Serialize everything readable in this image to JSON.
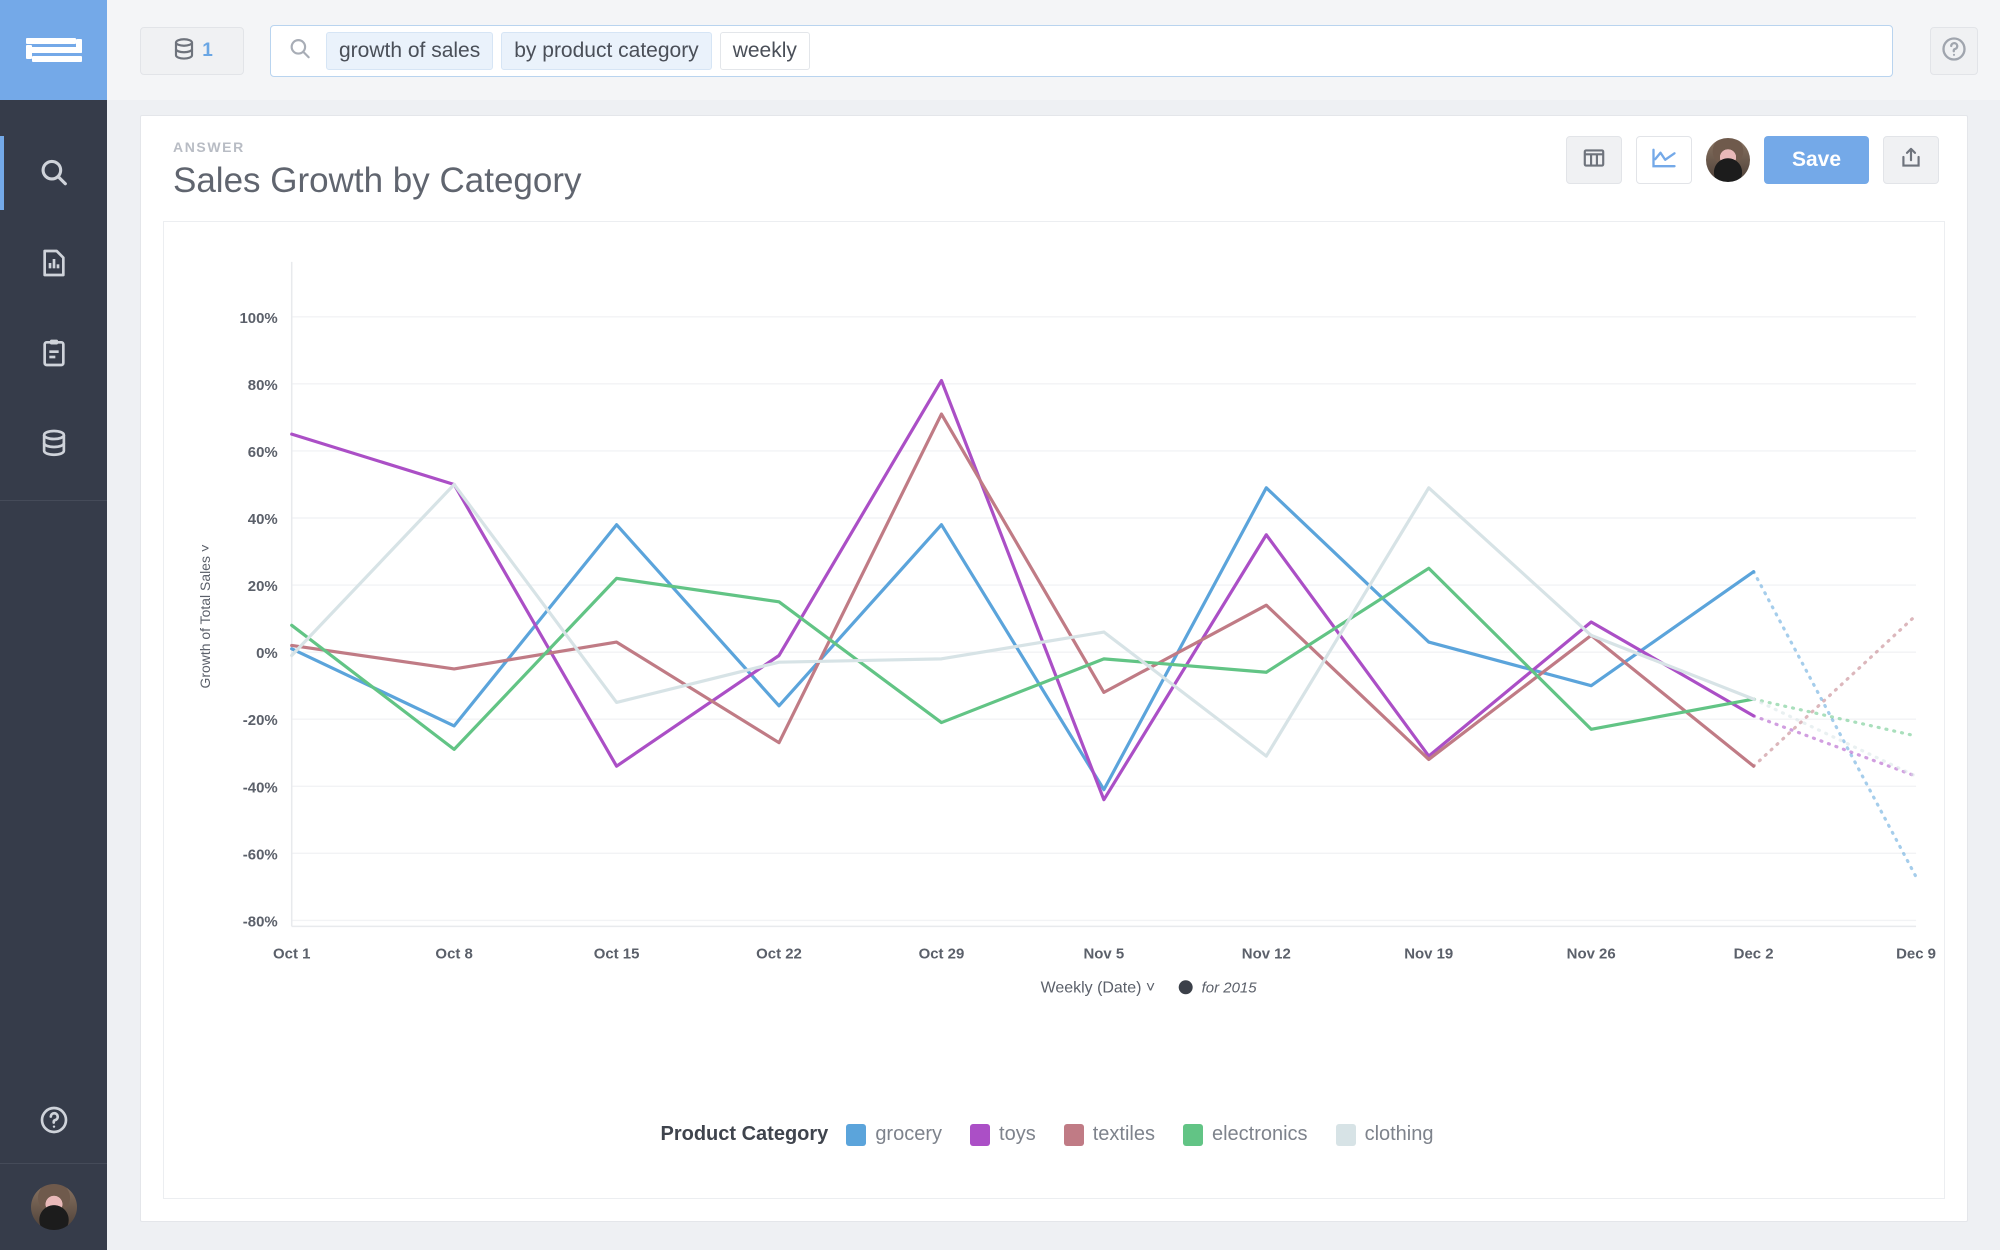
{
  "rail": {
    "logo_name": "thoughtspot-logo",
    "items": [
      {
        "name": "search",
        "icon": "search-icon",
        "active": true
      },
      {
        "name": "answers",
        "icon": "chart-document-icon",
        "active": false
      },
      {
        "name": "pinboards",
        "icon": "clipboard-icon",
        "active": false
      },
      {
        "name": "data",
        "icon": "database-icon",
        "active": false
      }
    ],
    "bottom": [
      {
        "name": "help",
        "icon": "help-circle-icon"
      },
      {
        "name": "profile",
        "icon": "avatar"
      }
    ]
  },
  "topbar": {
    "source_count": "1",
    "source_icon": "database-icon",
    "search_icon": "search-icon",
    "help_icon": "help-circle-icon",
    "tokens": [
      {
        "text": "growth of sales",
        "style": "filled"
      },
      {
        "text": "by product category",
        "style": "filled"
      },
      {
        "text": "weekly",
        "style": "plain"
      }
    ]
  },
  "card": {
    "eyebrow": "ANSWER",
    "title": "Sales Growth by Category",
    "actions": {
      "table_view": "table-view-icon",
      "chart_view": "line-chart-icon",
      "avatar": "avatar",
      "save_label": "Save",
      "share": "share-icon"
    }
  },
  "chart_data": {
    "type": "line",
    "title": "Sales Growth by Category",
    "xlabel": "Weekly (Date)",
    "xlabel_suffix": "for 2015",
    "xlabel_caret": "˅",
    "xlabel_clock_icon": "clock-icon",
    "ylabel": "Growth of Total Sales",
    "ylabel_caret": "˅",
    "ylim": [
      -80,
      100
    ],
    "ytick_labels": [
      "100%",
      "80%",
      "60%",
      "40%",
      "20%",
      "0%",
      "-20%",
      "-40%",
      "-60%",
      "-80%"
    ],
    "yticks": [
      100,
      80,
      60,
      40,
      20,
      0,
      -20,
      -40,
      -60,
      -80
    ],
    "grid": true,
    "legend_position": "bottom",
    "legend_title": "Product Category",
    "categories": [
      "Oct 1",
      "Oct 8",
      "Oct 15",
      "Oct 22",
      "Oct 29",
      "Nov 5",
      "Nov 12",
      "Nov 19",
      "Nov 26",
      "Dec 2",
      "Dec 9"
    ],
    "forecast_from_index": 9,
    "series": [
      {
        "name": "grocery",
        "color": "#5ba4db",
        "values": [
          1,
          -22,
          38,
          -16,
          38,
          -41,
          49,
          3,
          -10,
          24,
          -67
        ]
      },
      {
        "name": "toys",
        "color": "#ab4fc6",
        "values": [
          65,
          50,
          -34,
          -1,
          81,
          -44,
          35,
          -31,
          9,
          -19,
          -37
        ]
      },
      {
        "name": "textiles",
        "color": "#c07b85",
        "values": [
          2,
          -5,
          3,
          -27,
          71,
          -12,
          14,
          -32,
          5,
          -34,
          11
        ]
      },
      {
        "name": "electronics",
        "color": "#62c485",
        "values": [
          8,
          -29,
          22,
          15,
          -21,
          -2,
          -6,
          25,
          -23,
          -14,
          -25
        ]
      },
      {
        "name": "clothing",
        "color": "#d7e3e6",
        "values": [
          -1,
          50,
          -15,
          -3,
          -2,
          6,
          -31,
          49,
          5,
          -14,
          -37
        ]
      }
    ]
  }
}
